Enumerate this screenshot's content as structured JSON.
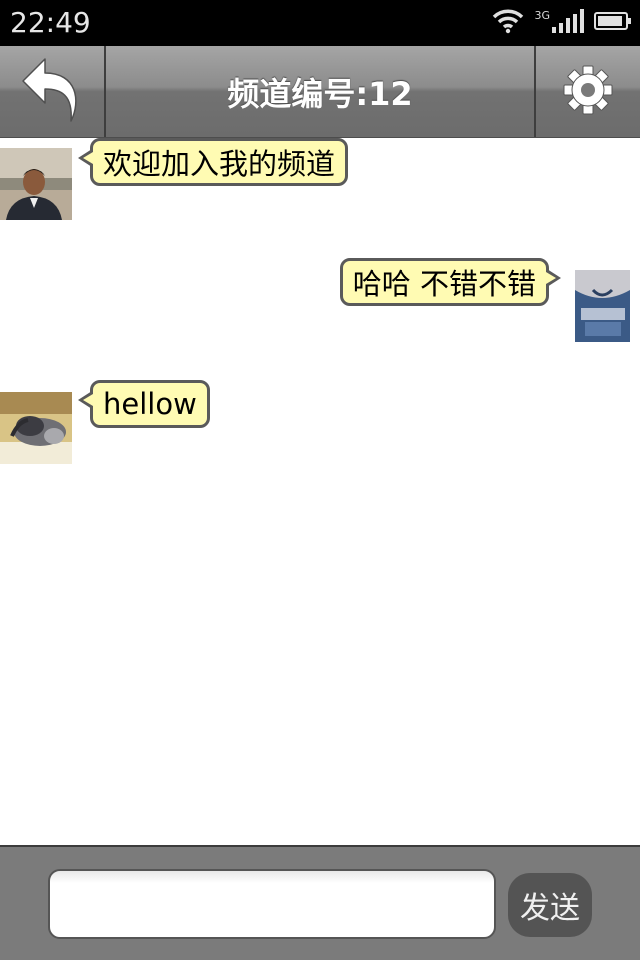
{
  "status_bar": {
    "time": "22:49",
    "network": "3G",
    "icons": [
      "wifi-icon",
      "signal-icon",
      "battery-icon"
    ]
  },
  "nav": {
    "title": "频道编号:12",
    "back_icon": "back-arrow-icon",
    "settings_icon": "gear-icon"
  },
  "messages": [
    {
      "side": "left",
      "text": "欢迎加入我的频道",
      "avatar": "avatar-person-outdoor"
    },
    {
      "side": "right",
      "text": "哈哈 不错不错",
      "avatar": "avatar-person-shirt"
    },
    {
      "side": "left",
      "text": "hellow",
      "avatar": "avatar-cat"
    }
  ],
  "composer": {
    "input_value": "",
    "send_label": "发送"
  },
  "colors": {
    "bubble": "#fffbb3",
    "bubble_border": "#5a5a5a",
    "nav_bar": "#7a7a7a",
    "input_bar": "#7b7b7b",
    "send_button": "#545454"
  }
}
